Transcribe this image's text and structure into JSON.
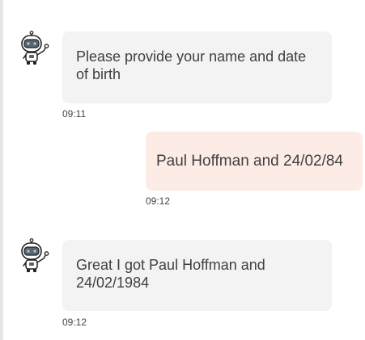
{
  "messages": [
    {
      "sender": "bot",
      "text": "Please provide your name and date of birth",
      "time": "09:11",
      "avatar_icon": "robot-icon"
    },
    {
      "sender": "user",
      "text": "Paul Hoffman and 24/02/84",
      "time": "09:12"
    },
    {
      "sender": "bot",
      "text": "Great I got Paul Hoffman and 24/02/1984",
      "time": "09:12",
      "avatar_icon": "robot-icon"
    }
  ],
  "colors": {
    "bot_bubble": "#f3f3f3",
    "user_bubble": "#fdebe6",
    "text": "#3f3f3f"
  }
}
